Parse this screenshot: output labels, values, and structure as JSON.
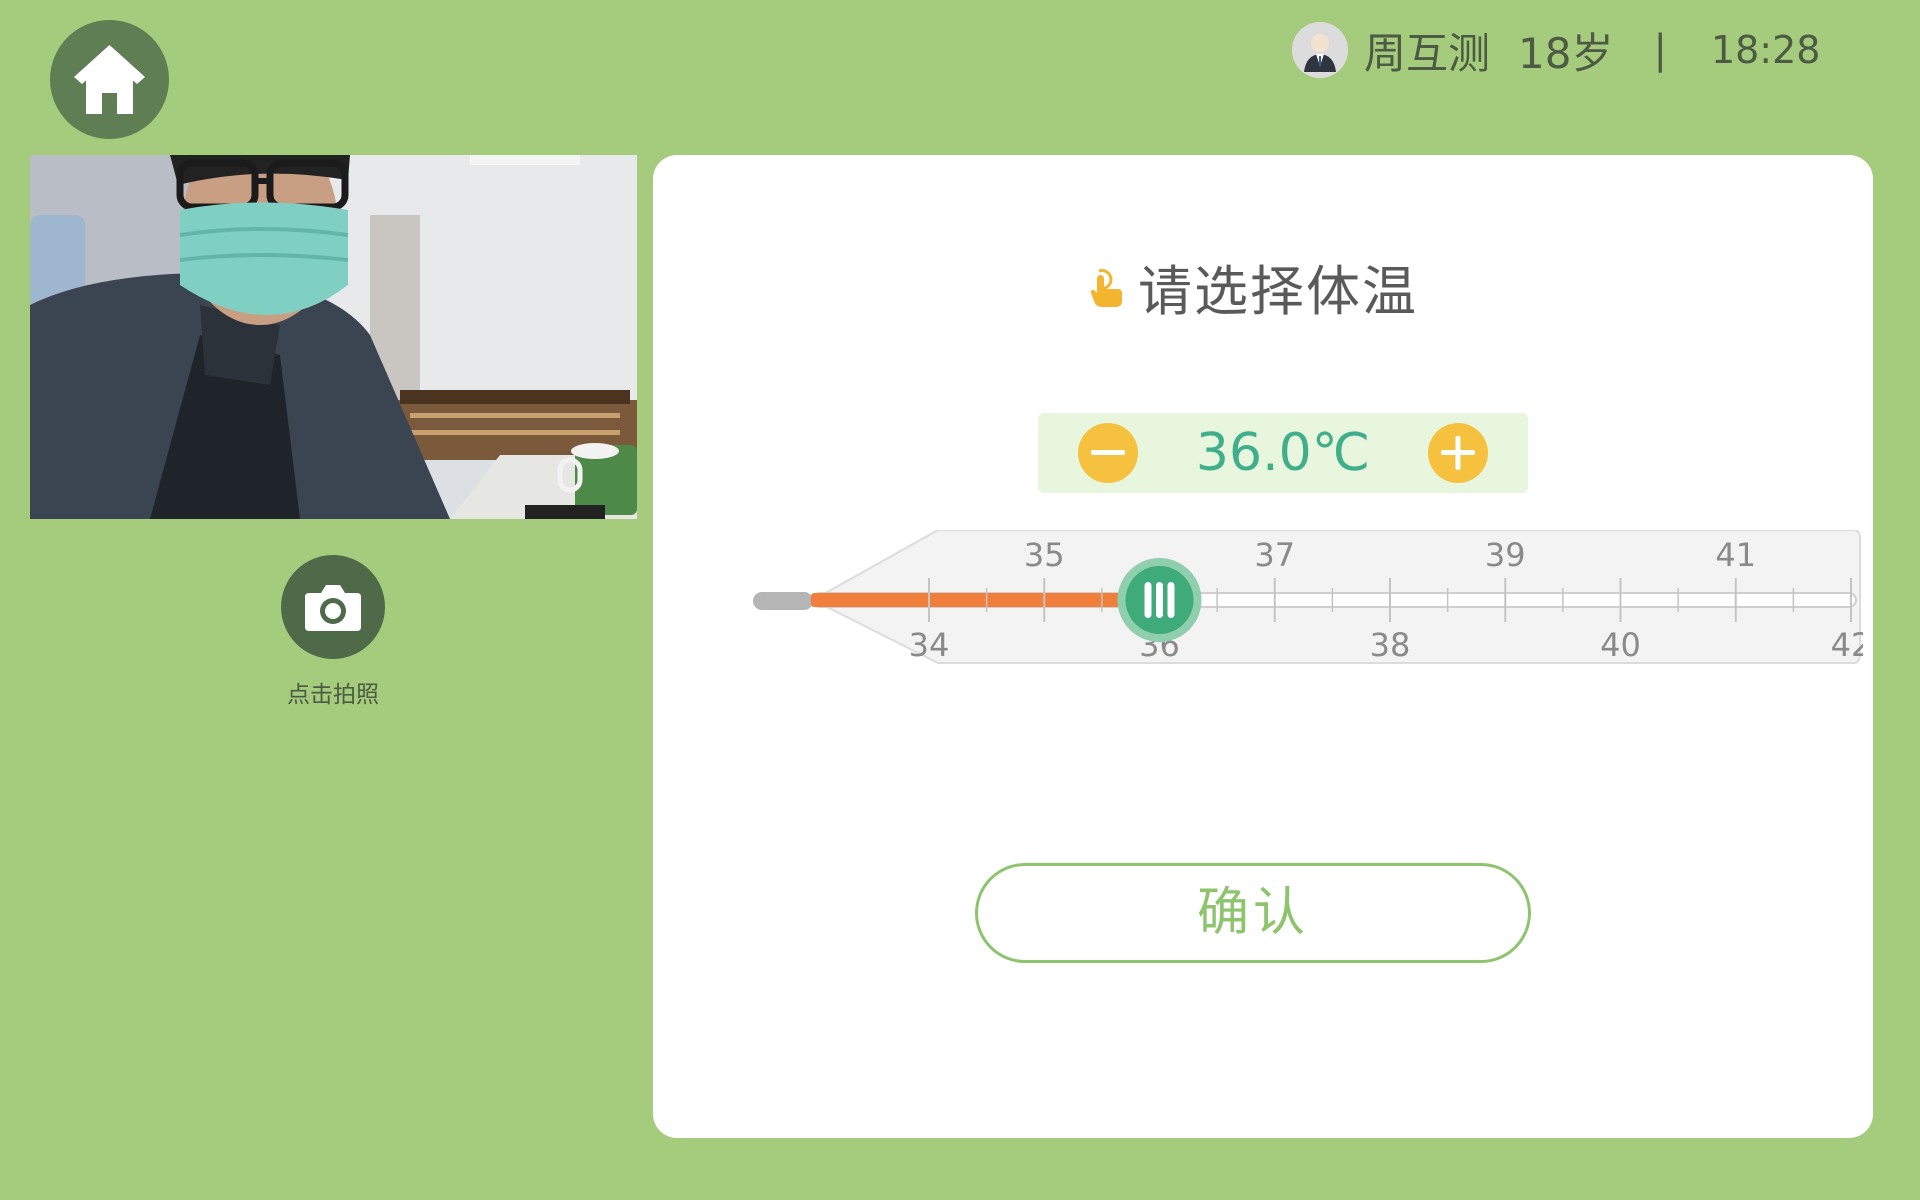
{
  "header": {
    "home_icon": "home-icon",
    "avatar_icon": "user-avatar",
    "user_name": "周互测",
    "user_age": "18岁",
    "separator": "|",
    "time": "18:28"
  },
  "camera": {
    "shutter_icon": "camera-icon",
    "shutter_label": "点击拍照"
  },
  "main": {
    "prompt_icon": "tap-hand-icon",
    "prompt": "请选择体温",
    "temperature": "36.0℃",
    "temperature_value": 36.0,
    "minus_icon": "minus-icon",
    "plus_icon": "plus-icon",
    "scale": {
      "min": 34,
      "max": 42,
      "upper_labels": [
        "35",
        "37",
        "39",
        "41"
      ],
      "lower_labels": [
        "34",
        "36",
        "38",
        "40",
        "42"
      ]
    },
    "confirm_label": "确认"
  },
  "colors": {
    "background": "#a5cb7c",
    "card": "#ffffff",
    "accent_green": "#3fae8a",
    "button_yellow": "#f6c13e",
    "mercury_orange": "#f07f3c",
    "confirm_green": "#8dc46d"
  }
}
